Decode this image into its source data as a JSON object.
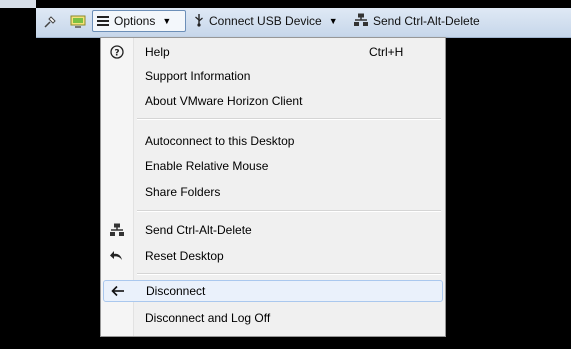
{
  "toolbar": {
    "options_label": "Options",
    "usb_label": "Connect USB Device",
    "cad_label": "Send Ctrl-Alt-Delete",
    "icons": [
      "pin-icon",
      "screen-icon",
      "hamburger-icon",
      "usb-icon",
      "network-icon"
    ]
  },
  "menu": {
    "help": {
      "label": "Help",
      "shortcut": "Ctrl+H",
      "icon": "help-circle-icon"
    },
    "support": {
      "label": "Support Information"
    },
    "about": {
      "label": "About VMware Horizon Client"
    },
    "autoconnect": {
      "label": "Autoconnect to this Desktop"
    },
    "relative_mouse": {
      "label": "Enable Relative Mouse"
    },
    "share_folders": {
      "label": "Share Folders"
    },
    "send_cad": {
      "label": "Send Ctrl-Alt-Delete",
      "icon": "network-icon"
    },
    "reset": {
      "label": "Reset Desktop",
      "icon": "undo-icon"
    },
    "disconnect": {
      "label": "Disconnect",
      "icon": "arrow-left-icon"
    },
    "logoff": {
      "label": "Disconnect and Log Off"
    }
  },
  "colors": {
    "background": "#000000",
    "toolbar": "#c6d6ea",
    "menu": "#f0f0f0",
    "hover": "#eaf1fb",
    "hover_border": "#aac8ee"
  }
}
